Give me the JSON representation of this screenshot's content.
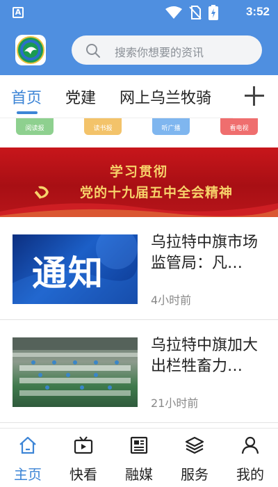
{
  "status_bar": {
    "time": "3:52",
    "app_badge": "A",
    "icons": [
      "wifi-icon",
      "no-sim-icon",
      "battery-charging-icon"
    ]
  },
  "header": {
    "search_placeholder": "搜索你想要的资讯",
    "logo_icon": "county-emblem-logo"
  },
  "tabs": [
    {
      "label": "首页",
      "active": true
    },
    {
      "label": "党建",
      "active": false
    },
    {
      "label": "网上乌兰牧骑",
      "active": false
    }
  ],
  "quick_links": [
    {
      "label": "阅读报",
      "color": "#8ed08f"
    },
    {
      "label": "读书报",
      "color": "#f3c36a"
    },
    {
      "label": "听广播",
      "color": "#7fb6ef"
    },
    {
      "label": "看电视",
      "color": "#ef6e6e"
    }
  ],
  "banner": {
    "line1": "学习贯彻",
    "line2": "党的十九届五中全会精神"
  },
  "news": [
    {
      "title": "乌拉特中旗市场监管局：凡…",
      "time": "4小时前",
      "thumb_text": "通知"
    },
    {
      "title": "乌拉特中旗加大出栏牲畜力…",
      "time": "21小时前"
    }
  ],
  "bottom_nav": [
    {
      "label": "主页",
      "icon": "home-icon",
      "active": true
    },
    {
      "label": "快看",
      "icon": "video-icon",
      "active": false
    },
    {
      "label": "融媒",
      "icon": "newspaper-icon",
      "active": false
    },
    {
      "label": "服务",
      "icon": "layers-icon",
      "active": false
    },
    {
      "label": "我的",
      "icon": "user-icon",
      "active": false
    }
  ],
  "colors": {
    "brand_blue": "#4f8fe0",
    "active_blue": "#3d85d6",
    "banner_red": "#c8161b",
    "banner_gold": "#f7d26a"
  }
}
